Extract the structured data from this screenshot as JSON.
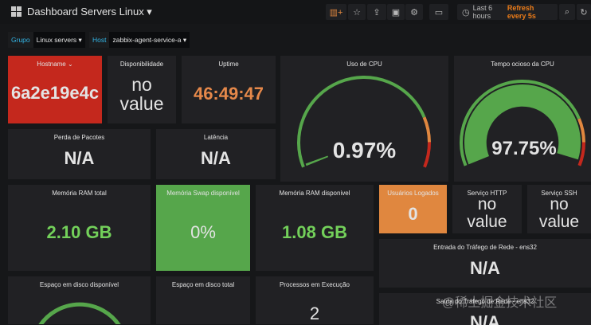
{
  "header": {
    "title": "Dashboard Servers Linux ▾",
    "time_range": "Last 6 hours",
    "refresh": "Refresh every 5s",
    "icons": [
      "add-panel-icon",
      "star-icon",
      "share-icon",
      "save-icon",
      "gear-icon",
      "tv-mode-icon",
      "search-icon",
      "refresh-icon"
    ]
  },
  "variables": [
    {
      "label": "Grupo",
      "value": "Linux servers ▾"
    },
    {
      "label": "Host",
      "value": "zabbix-agent-service-a ▾"
    }
  ],
  "panels": {
    "hostname": {
      "title": "Hostname ⌄",
      "value": "6a2e19e4c"
    },
    "disponibilidade": {
      "title": "Disponibilidade",
      "value1": "no",
      "value2": "value"
    },
    "uptime": {
      "title": "Uptime",
      "value": "46:49:47"
    },
    "cpu": {
      "title": "Uso de CPU",
      "value": "0.97%",
      "num": 0.97
    },
    "idle": {
      "title": "Tempo ocioso da CPU",
      "value": "97.75%",
      "num": 97.75
    },
    "perda": {
      "title": "Perda de Pacotes",
      "value": "N/A"
    },
    "latencia": {
      "title": "Latência",
      "value": "N/A"
    },
    "ram_total": {
      "title": "Memória RAM total",
      "value": "2.10 GB"
    },
    "swap": {
      "title": "Memória Swap disponível",
      "value": "0%"
    },
    "ram_disp": {
      "title": "Memória RAM disponivel",
      "value": "1.08 GB"
    },
    "usuarios": {
      "title": "Usuários Logados",
      "value": "0"
    },
    "http": {
      "title": "Serviço HTTP",
      "value1": "no",
      "value2": "value"
    },
    "ssh": {
      "title": "Serviço SSH",
      "value1": "no",
      "value2": "value"
    },
    "entrada": {
      "title": "Entrada do Tráfego de Rede - ens32",
      "value": "N/A"
    },
    "saida": {
      "title": "Saída do Tráfego de Rede - ens32",
      "value": "N/A"
    },
    "disco_disp": {
      "title": "Espaço em disco disponível"
    },
    "disco_total": {
      "title": "Espaço em disco total"
    },
    "processos": {
      "title": "Processos em Execução",
      "value": "2"
    }
  },
  "colors": {
    "red": "#c4281d",
    "orange": "#e0873f",
    "green": "#56a64b",
    "value_orange": "#e5884a",
    "value_green": "#73d05a"
  },
  "watermark": "@稀土掘金技术社区"
}
